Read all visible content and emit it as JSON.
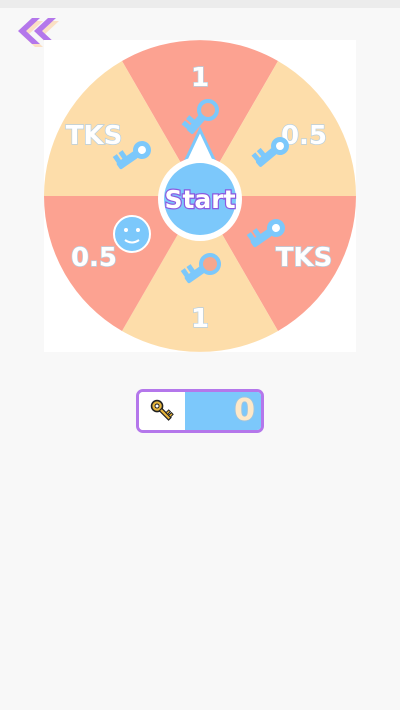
{
  "nav": {
    "back_icon": "double-chevron-left-icon"
  },
  "colors": {
    "segment_peach": "#fdddaa",
    "segment_coral": "#fca291",
    "accent_purple": "#b477eb",
    "key_blue": "#7cc8fb",
    "start_outline": "#8b58e0"
  },
  "wheel": {
    "start_label": "Start",
    "segments": [
      {
        "label": "1",
        "icon": "key-icon"
      },
      {
        "label": "0.5",
        "icon": "key-icon"
      },
      {
        "label": "TKS",
        "icon": "key-icon"
      },
      {
        "label": "1",
        "icon": "key-icon"
      },
      {
        "label": "0.5",
        "icon": "smiley-face-icon"
      },
      {
        "label": "TKS",
        "icon": "key-icon"
      }
    ],
    "pointer_icon": "key-icon"
  },
  "counter": {
    "icon": "gold-key-icon",
    "value": "0"
  }
}
